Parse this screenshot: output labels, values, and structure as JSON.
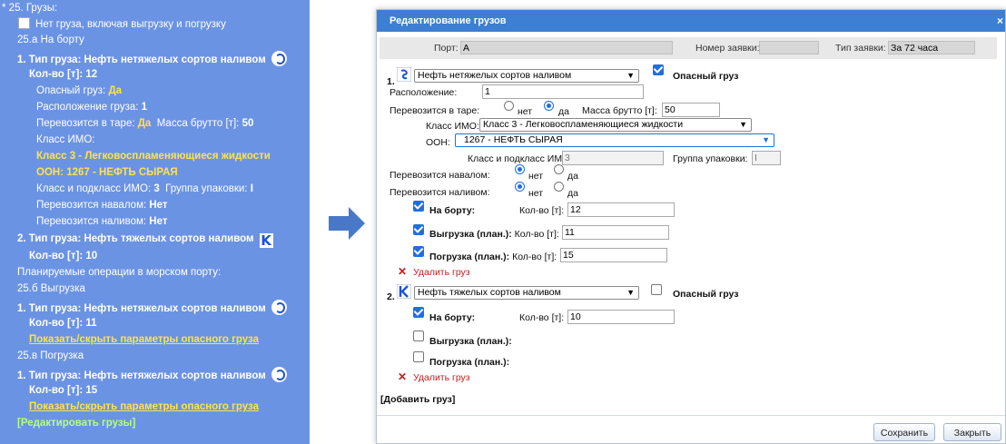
{
  "left": {
    "section_title": "25. Грузы:",
    "no_cargo": "Нет груза, включая выгрузку и погрузку",
    "onboard_header": "25.а На борту",
    "c1_title": "1. Тип груза: Нефть нетяжелых сортов наливом",
    "qty_label": "Кол-во [т]:",
    "c1_qty": "12",
    "in_tare_dangerous": "Опасный груз:",
    "yes": "Да",
    "location_label": "Расположение груза:",
    "location_value": "1",
    "in_tare_label": "Перевозится в таре:",
    "gross_label": "Масса брутто [т]:",
    "gross_value": "50",
    "imo_class_label": "Класс ИМО:",
    "imo_class_value": "Класс 3 - Легковоспламеняющиеся жидкости",
    "oon_value": "ООН: 1267 - НЕФТЬ СЫРАЯ",
    "imo_subclass_label": "Класс и подкласс ИМО:",
    "imo_subclass_value": "3",
    "pack_group_label": "Группа упаковки:",
    "pack_group_value": "I",
    "bulk_label": "Перевозится навалом:",
    "no": "Нет",
    "liquid_label": "Перевозится наливом:",
    "c2_title": "2. Тип груза: Нефть тяжелых сортов наливом",
    "c2_qty": "10",
    "planned_ops": "Планируемые операции в морском порту:",
    "unload_header": "25.б Выгрузка",
    "unload_qty": "11",
    "toggle_link": "Показать/скрыть параметры опасного груза",
    "load_header": "25.в Погрузка",
    "load_qty": "15",
    "edit_link": "[Редактировать грузы]"
  },
  "dialog": {
    "title": "Редактирование грузов",
    "close": "×",
    "port_label": "Порт:",
    "port_value": "А",
    "request_no_label": "Номер заявки:",
    "request_no_value": "",
    "request_type_label": "Тип заявки:",
    "request_type_value": "За 72 часа",
    "c1": {
      "num": "1.",
      "type_value": "Нефть нетяжелых сортов наливом",
      "dangerous_label": "Опасный груз",
      "location_label": "Расположение:",
      "location_value": "1",
      "in_tare_label": "Перевозится в таре:",
      "no": "нет",
      "yes": "да",
      "gross_label": "Масса брутто [т]:",
      "gross_value": "50",
      "imo_label": "Класс ИМО:",
      "imo_value": "Класс 3 - Легковоспламеняющиеся жидкости",
      "oon_label": "ООН:",
      "oon_value": "1267 - НЕФТЬ СЫРАЯ",
      "subclass_label": "Класс и подкласс ИМО:",
      "subclass_value": "3",
      "pack_label": "Группа упаковки:",
      "pack_value": "I",
      "bulk_label": "Перевозится навалом:",
      "liquid_label": "Перевозится наливом:",
      "onboard_label": "На борту:",
      "qty_label": "Кол-во [т]:",
      "onboard_value": "12",
      "unload_label": "Выгрузка (план.):",
      "unload_value": "11",
      "load_label": "Погрузка (план.):",
      "load_value": "15",
      "delete": "Удалить груз"
    },
    "c2": {
      "num": "2.",
      "type_value": "Нефть тяжелых сортов наливом",
      "dangerous_label": "Опасный груз",
      "onboard_label": "На борту:",
      "qty_label": "Кол-во [т]:",
      "onboard_value": "10",
      "unload_label": "Выгрузка (план.):",
      "load_label": "Погрузка (план.):",
      "delete": "Удалить груз"
    },
    "add_cargo": "[Добавить груз]",
    "save": "Сохранить",
    "close_btn": "Закрыть"
  },
  "colors": {
    "panel": "#6b93e4",
    "accent_yellow": "#ffe34a",
    "link_green": "#b6ff7a",
    "title_bar": "#3d7fd3",
    "delete_red": "#c62020"
  }
}
